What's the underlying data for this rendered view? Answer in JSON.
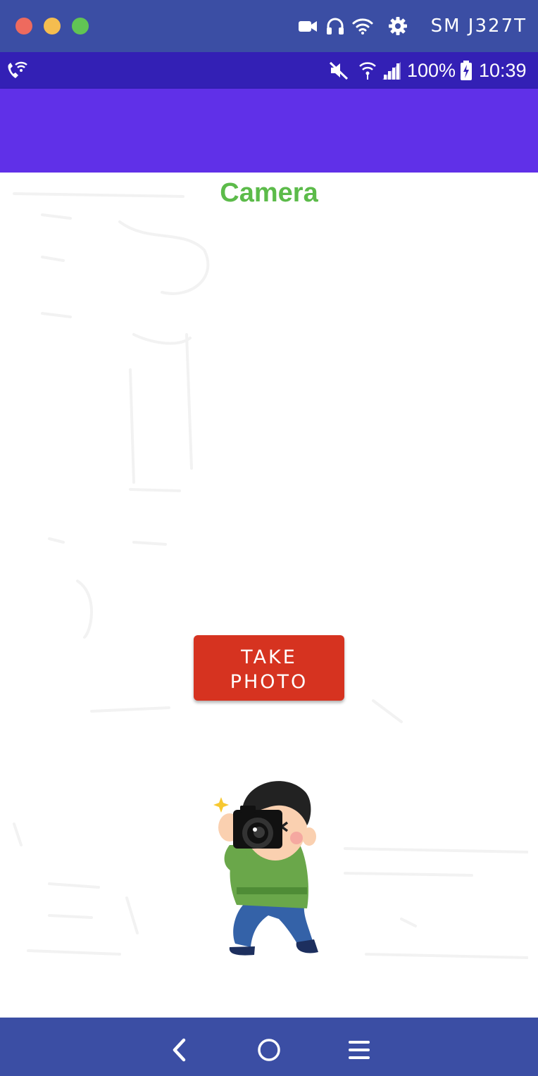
{
  "window": {
    "device_name": "SM J327T",
    "icons": [
      "video-icon",
      "headphones-icon",
      "wifi-icon",
      "gear-icon"
    ]
  },
  "status_bar": {
    "battery_percent": "100%",
    "time": "10:39",
    "icons": [
      "wifi-call-icon",
      "mute-icon",
      "wifi-signal-icon",
      "cell-signal-icon",
      "battery-charging-icon"
    ]
  },
  "app": {
    "title": "Camera",
    "take_photo_label": "TAKE PHOTO",
    "illustration": "photographer-illustration"
  },
  "colors": {
    "title_bar": "#3b4ea4",
    "status_bar": "#3320b5",
    "app_bar": "#6030e8",
    "title_text": "#5cbb4a",
    "button": "#d63320",
    "nav_bar": "#3b4ea4"
  },
  "nav": {
    "icons": [
      "back-icon",
      "home-icon",
      "recents-icon"
    ]
  }
}
